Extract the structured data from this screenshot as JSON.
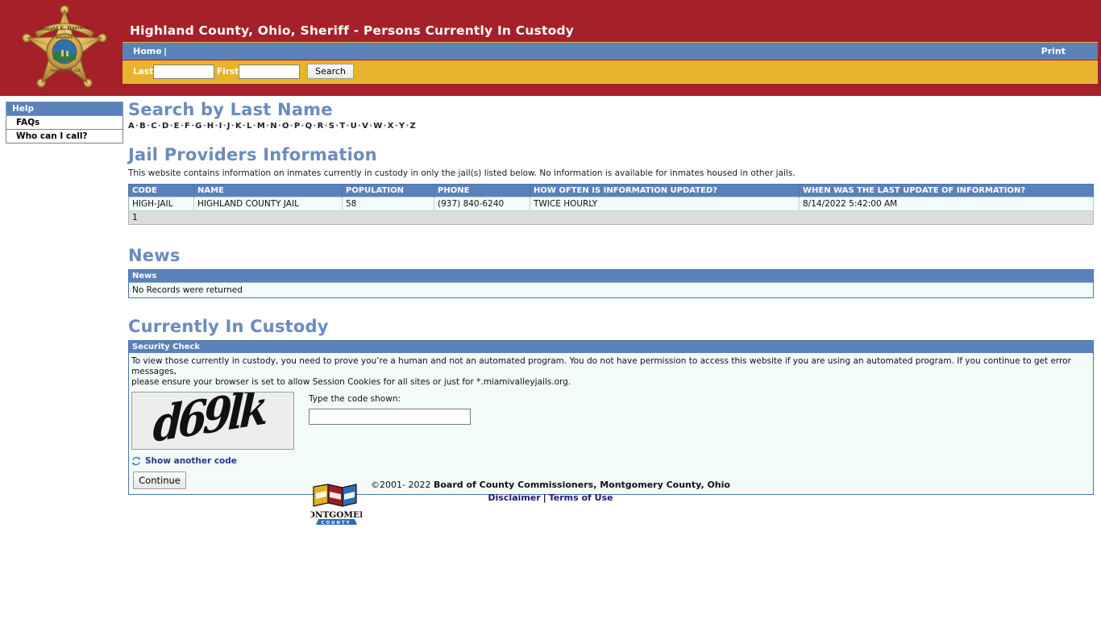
{
  "header": {
    "title": "Highland County, Ohio, Sheriff - Persons Currently In Custody",
    "badge": {
      "sheriff_name": "Donald E. Barrera",
      "rank_text": "SHERIFF",
      "county_text": "HIGHLAND COUNTY",
      "icon": "sheriff-star-badge"
    },
    "nav": {
      "home_label": "Home",
      "separator": "|",
      "print_label": "Print"
    },
    "search": {
      "last_label": "Last",
      "last_value": "",
      "last_placeholder": "",
      "first_label": "First",
      "first_value": "",
      "first_placeholder": "",
      "button_label": "Search"
    },
    "colors": {
      "banner_red": "#A52029",
      "nav_blue": "#5B81BB",
      "search_gold": "#E8B430"
    }
  },
  "sidebar": {
    "header_label": "Help",
    "items": [
      {
        "label": "FAQs"
      },
      {
        "label": "Who can I call?"
      }
    ]
  },
  "main": {
    "search_by_last_name": {
      "heading": "Search by Last Name",
      "letters": [
        "A",
        "B",
        "C",
        "D",
        "E",
        "F",
        "G",
        "H",
        "I",
        "J",
        "K",
        "L",
        "M",
        "N",
        "O",
        "P",
        "Q",
        "R",
        "S",
        "T",
        "U",
        "V",
        "W",
        "X",
        "Y",
        "Z"
      ],
      "separator": "·"
    },
    "jail_providers": {
      "heading": "Jail Providers Information",
      "description": "This website contains information on inmates currently in custody in only the jail(s) listed below. No information is available for inmates housed in other jails.",
      "columns": [
        "CODE",
        "NAME",
        "POPULATION",
        "PHONE",
        "HOW OFTEN IS INFORMATION UPDATED?",
        "WHEN WAS THE LAST UPDATE OF INFORMATION?"
      ],
      "rows": [
        {
          "code": "HIGH-JAIL",
          "name": "HIGHLAND COUNTY JAIL",
          "population": "58",
          "phone": "(937) 840-6240",
          "update_frequency": "TWICE HOURLY",
          "last_update": "8/14/2022 5:42:00 AM"
        }
      ],
      "pager_label": "1"
    },
    "news": {
      "heading": "News",
      "table_header": "News",
      "empty_message": "No Records were returned"
    },
    "currently_in_custody": {
      "heading": "Currently In Custody",
      "security_check": {
        "panel_title": "Security Check",
        "instructions_line1": "To view those currently in custody, you need to prove you’re a human and not an automated program. You do not have permission to access this website if you are using an automated program. If you continue to get error messages,",
        "instructions_line2": "please ensure your browser is set to allow Session Cookies for all sites or just for *.miamivalleyjails.org.",
        "captcha_code": "d69lk",
        "code_label": "Type the code shown:",
        "code_value": "",
        "code_placeholder": "",
        "show_another_label": "Show another code",
        "refresh_icon": "refresh-icon",
        "continue_label": "Continue"
      }
    }
  },
  "footer": {
    "logo_alt": "montgomery-county-logo",
    "logo_text_main": "MONTGOMERY",
    "logo_text_sub": "C O U N T Y",
    "copyright_prefix": "©2001- 2022 ",
    "copyright_bold": "Board of County Commissioners, Montgomery County, Ohio",
    "disclaimer_label": "Disclaimer",
    "pipe": "|",
    "terms_label": "Terms of Use"
  }
}
